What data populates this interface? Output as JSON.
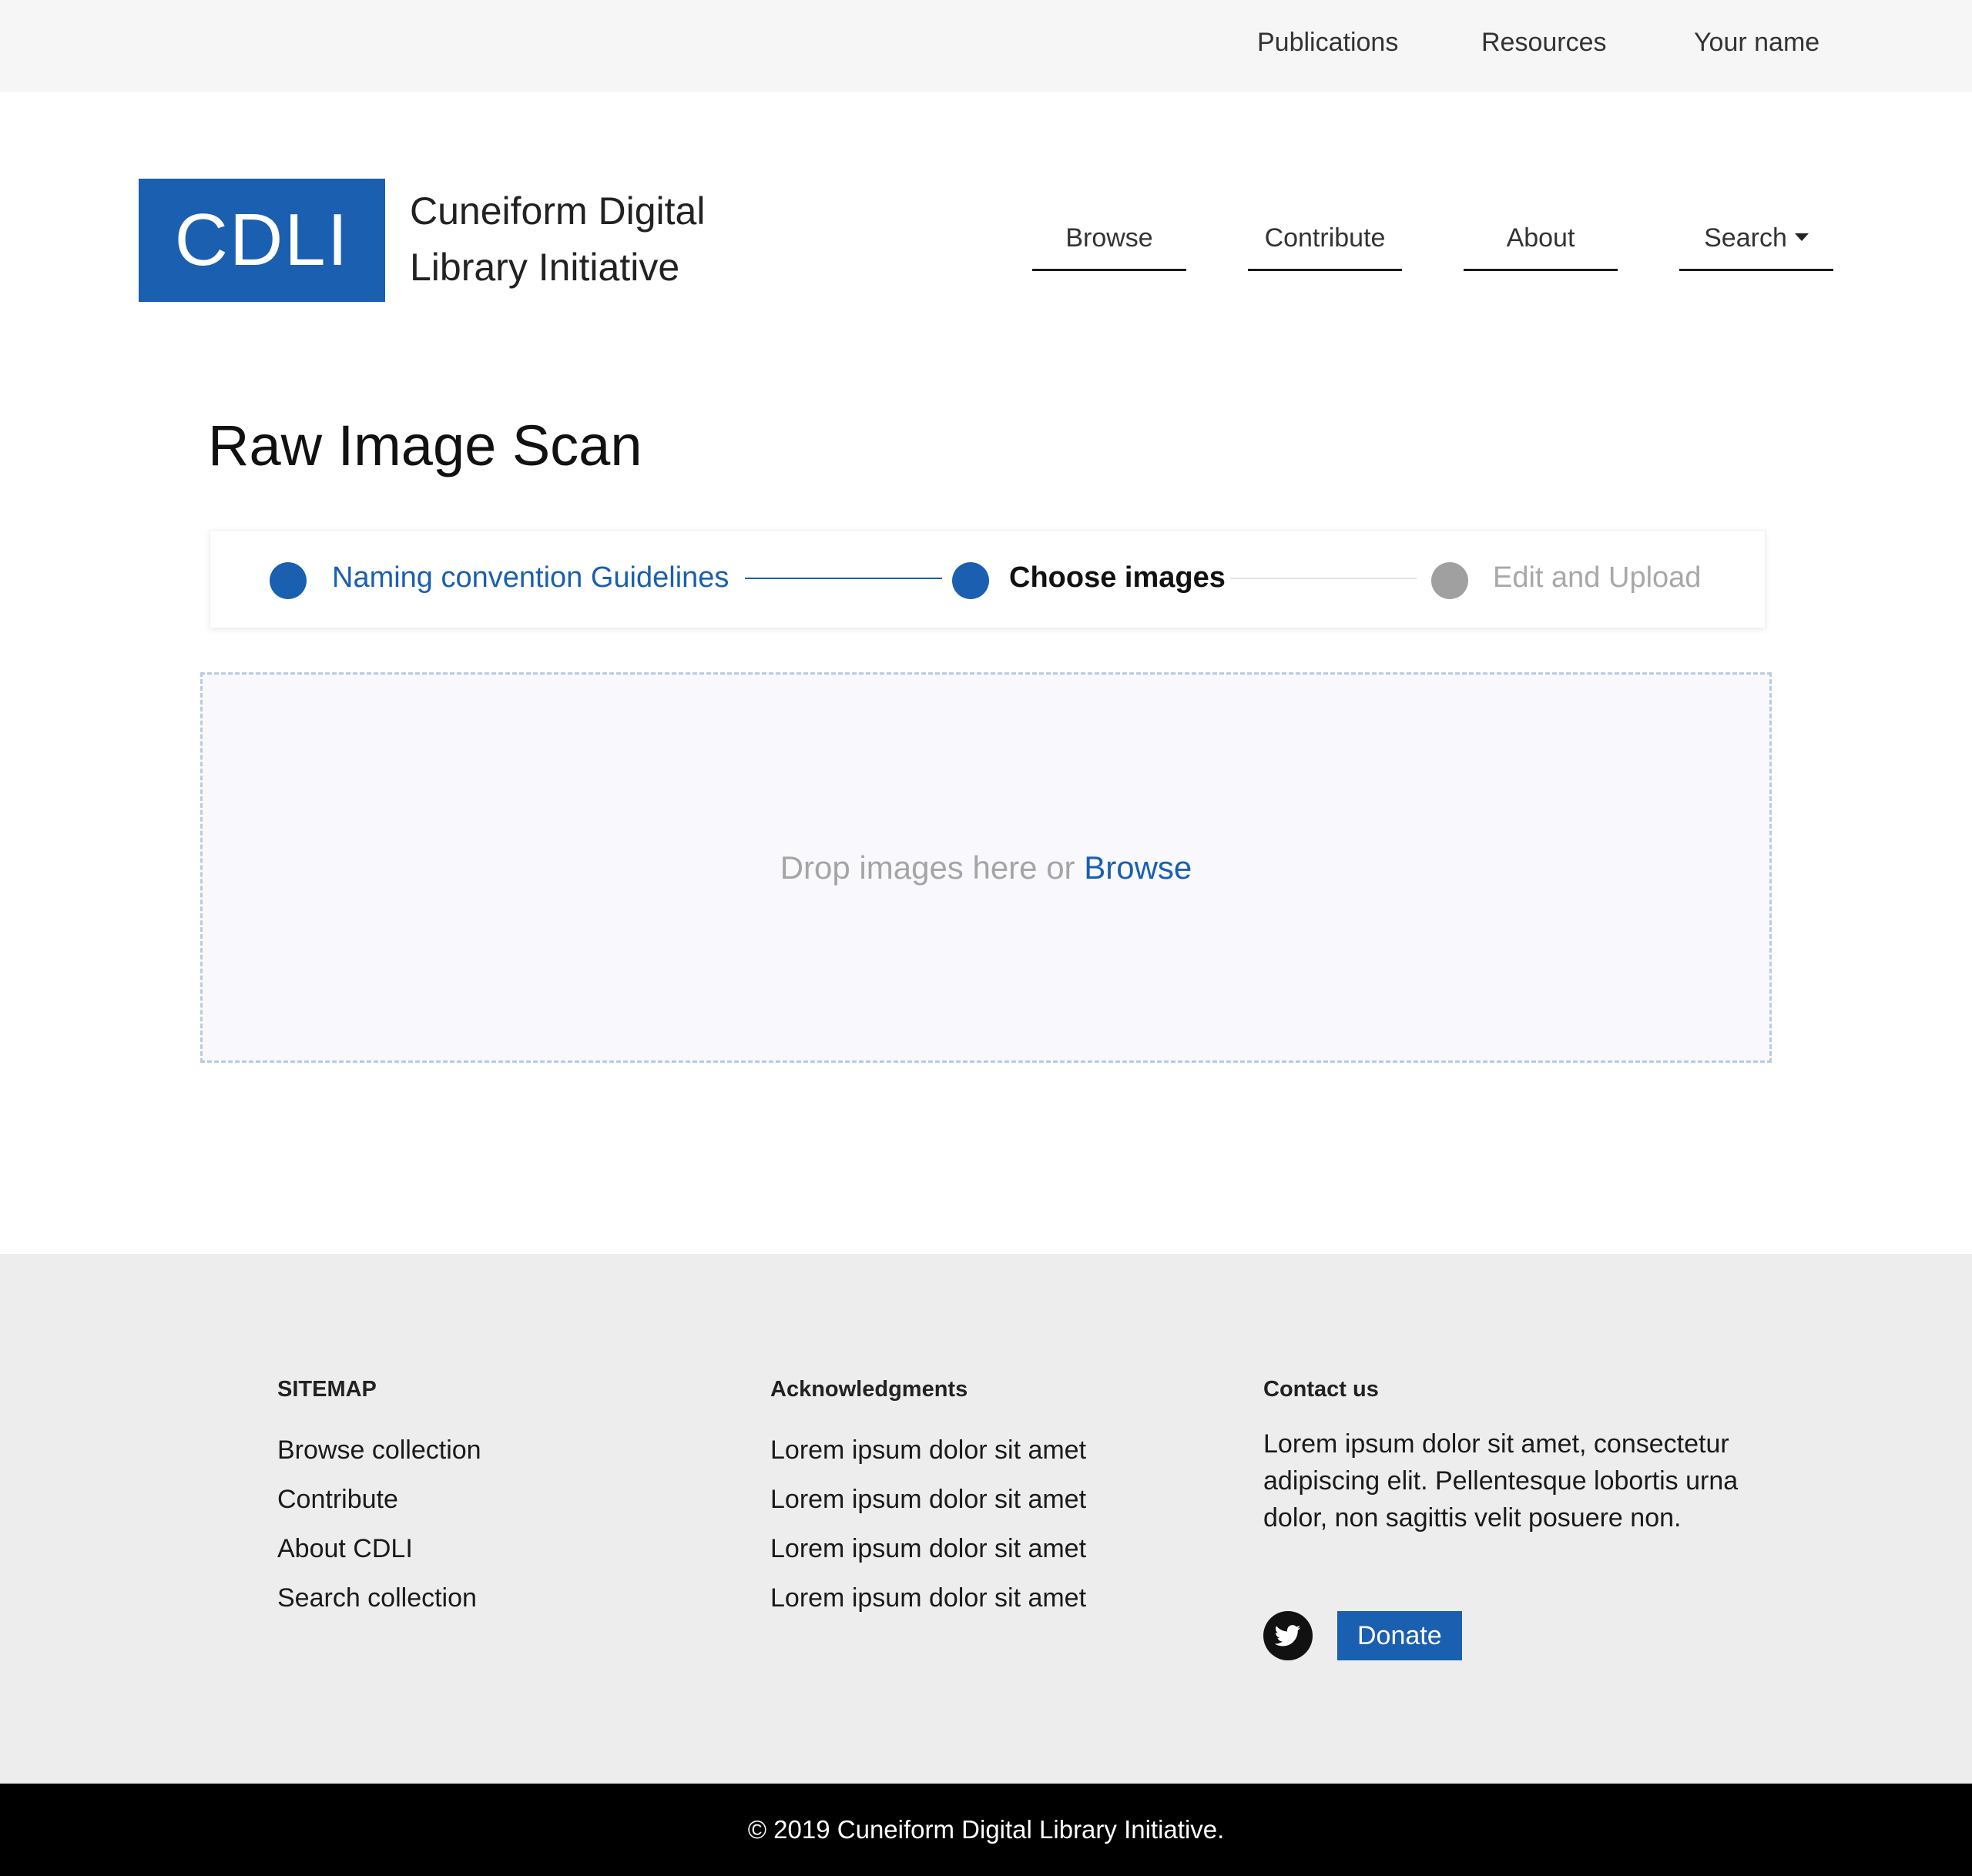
{
  "topbar": {
    "links": [
      "Publications",
      "Resources",
      "Your name"
    ]
  },
  "header": {
    "logo": "CDLI",
    "site_name_line1": "Cuneiform Digital",
    "site_name_line2": "Library Initiative",
    "nav": [
      "Browse",
      "Contribute",
      "About",
      "Search"
    ]
  },
  "page": {
    "title": "Raw Image Scan"
  },
  "stepper": {
    "steps": [
      {
        "label": "Naming convention Guidelines",
        "state": "completed"
      },
      {
        "label": "Choose images",
        "state": "active"
      },
      {
        "label": "Edit and Upload",
        "state": "pending"
      }
    ],
    "colors": {
      "active": "#1a5fb0",
      "pending": "#a0a0a0"
    }
  },
  "dropzone": {
    "text": "Drop images here or",
    "browse_label": "Browse"
  },
  "footer": {
    "sitemap": {
      "heading": "SITEMAP",
      "links": [
        "Browse collection",
        "Contribute",
        "About CDLI",
        "Search collection"
      ]
    },
    "acknowledgments": {
      "heading": "Acknowledgments",
      "items": [
        "Lorem ipsum dolor sit amet",
        "Lorem ipsum dolor sit amet",
        "Lorem ipsum dolor sit amet",
        "Lorem ipsum dolor sit amet"
      ]
    },
    "contact": {
      "heading": "Contact us",
      "text": "Lorem ipsum dolor sit amet, consectetur adipiscing elit. Pellentesque lobortis urna dolor, non sagittis velit posuere non.",
      "social_icon": "twitter-icon",
      "donate_label": "Donate"
    },
    "copyright": "© 2019 Cuneiform Digital Library Initiative."
  },
  "brand_color": "#1a5fb0"
}
